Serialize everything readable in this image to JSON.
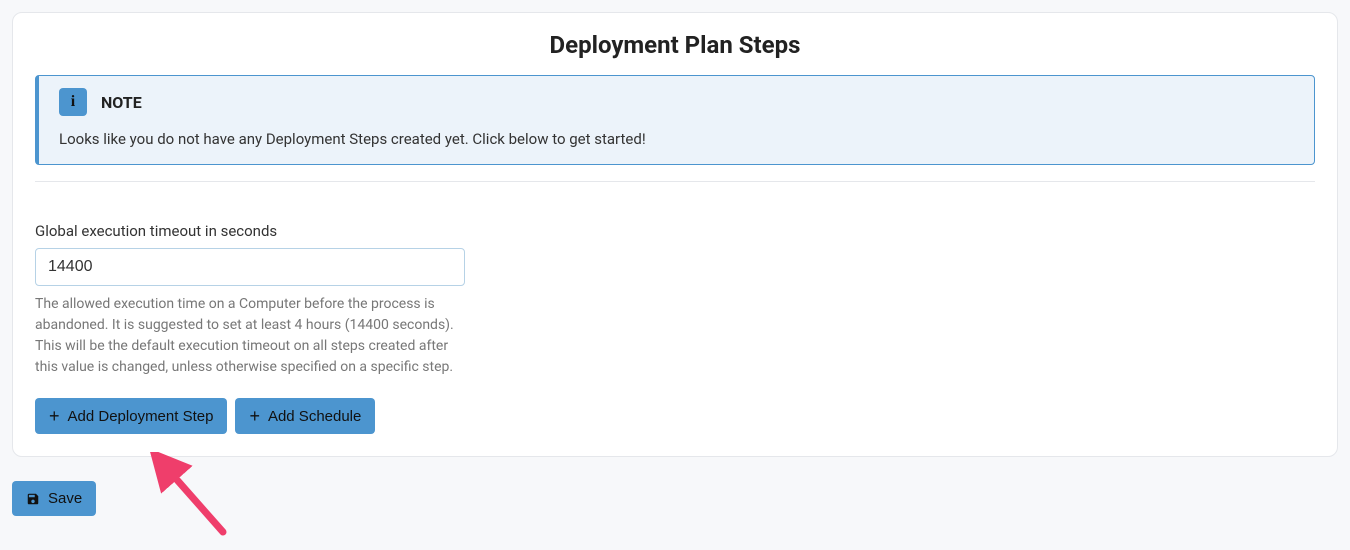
{
  "header": {
    "title": "Deployment Plan Steps"
  },
  "note": {
    "icon_glyph": "i",
    "title": "NOTE",
    "body": "Looks like you do not have any Deployment Steps created yet. Click below to get started!"
  },
  "timeout_field": {
    "label": "Global execution timeout in seconds",
    "value": "14400",
    "help": "The allowed execution time on a Computer before the process is abandoned. It is suggested to set at least 4 hours (14400 seconds). This will be the default execution timeout on all steps created after this value is changed, unless otherwise specified on a specific step."
  },
  "buttons": {
    "add_step": "Add Deployment Step",
    "add_schedule": "Add Schedule",
    "save": "Save"
  },
  "colors": {
    "accent": "#4c95cf",
    "note_bg": "#ecf3fa",
    "border": "#e5e7eb",
    "annotation": "#ef3e6b"
  }
}
